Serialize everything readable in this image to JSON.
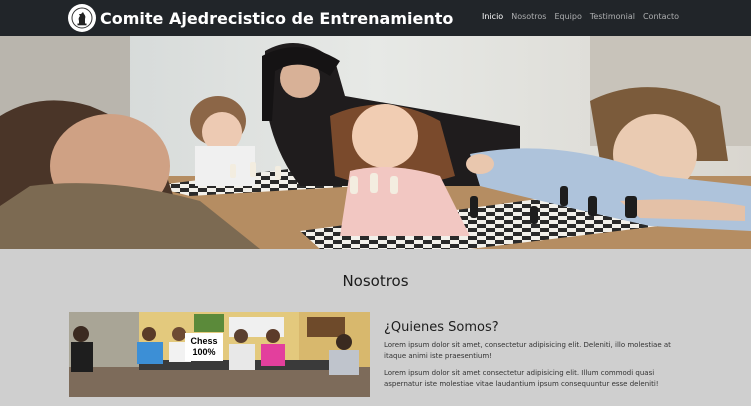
{
  "navbar": {
    "brand_title": "Comite Ajedrecistico de Entrenamiento",
    "links": [
      {
        "label": "Inicio",
        "active": true
      },
      {
        "label": "Nosotros",
        "active": false
      },
      {
        "label": "Equipo",
        "active": false
      },
      {
        "label": "Testimonial",
        "active": false
      },
      {
        "label": "Contacto",
        "active": false
      }
    ]
  },
  "nosotros": {
    "title": "Nosotros",
    "photo_sign": {
      "line1": "Chess",
      "line2": "100%"
    },
    "heading": "¿Quienes Somos?",
    "paragraph1": "Lorem ipsum dolor sit amet, consectetur adipisicing elit. Deleniti, illo molestiae at itaque animi iste praesentium!",
    "paragraph2": "Lorem ipsum dolor sit amet consectetur adipisicing elit. Illum commodi quasi aspernatur iste molestiae vitae laudantium ipsum consequuntur esse deleniti!"
  },
  "colors": {
    "navbar_bg": "#212529",
    "page_bg": "#cfcfcf",
    "nav_active": "#ffffff",
    "nav_inactive": "#9ea0a3"
  }
}
